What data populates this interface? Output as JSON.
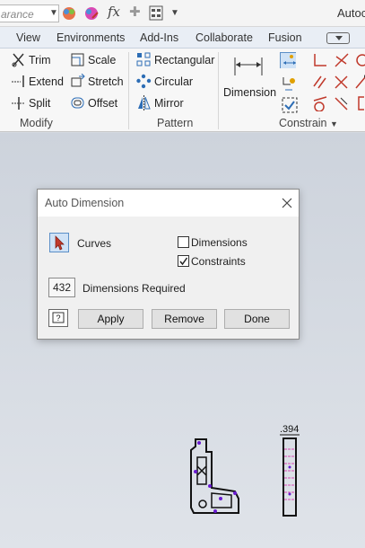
{
  "qat": {
    "appearance_text": "arance",
    "app_title": "Autoc"
  },
  "tabs": [
    {
      "label": "View"
    },
    {
      "label": "Environments"
    },
    {
      "label": "Add-Ins"
    },
    {
      "label": "Collaborate"
    },
    {
      "label": "Fusion"
    }
  ],
  "ribbon": {
    "modify": {
      "label": "Modify",
      "items": [
        {
          "label": "Trim"
        },
        {
          "label": "Scale"
        },
        {
          "label": "Extend"
        },
        {
          "label": "Stretch"
        },
        {
          "label": "Split"
        },
        {
          "label": "Offset"
        }
      ]
    },
    "pattern": {
      "label": "Pattern",
      "items": [
        {
          "label": "Rectangular"
        },
        {
          "label": "Circular"
        },
        {
          "label": "Mirror"
        }
      ]
    },
    "constrain": {
      "label": "Constrain",
      "dimension_label": "Dimension"
    }
  },
  "dialog": {
    "title": "Auto Dimension",
    "curves_label": "Curves",
    "dimensions_label": "Dimensions",
    "dimensions_checked": false,
    "constraints_label": "Constraints",
    "constraints_checked": true,
    "count_value": "432",
    "count_label": "Dimensions Required",
    "buttons": {
      "apply": "Apply",
      "remove": "Remove",
      "done": "Done"
    }
  },
  "canvas": {
    "dimension_text": ".394"
  },
  "colors": {
    "accent_blue": "#2d6db5",
    "constraint_red": "#c0392b",
    "sketch_purple": "#6a1bd1"
  }
}
